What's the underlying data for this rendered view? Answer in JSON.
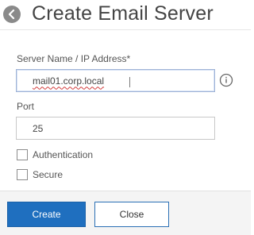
{
  "header": {
    "title": "Create Email Server"
  },
  "form": {
    "server_name": {
      "label": "Server Name / IP Address*",
      "value": "mail01.corp.local"
    },
    "port": {
      "label": "Port",
      "value": "25"
    },
    "authentication": {
      "label": "Authentication",
      "checked": false
    },
    "secure": {
      "label": "Secure",
      "checked": false
    }
  },
  "buttons": {
    "create": "Create",
    "close": "Close"
  },
  "icons": {
    "back": "back-arrow-icon",
    "info": "info-icon"
  },
  "colors": {
    "primary": "#1f6fbf",
    "back_circle": "#8a8a8a",
    "footer_bg": "#f4f4f4"
  }
}
